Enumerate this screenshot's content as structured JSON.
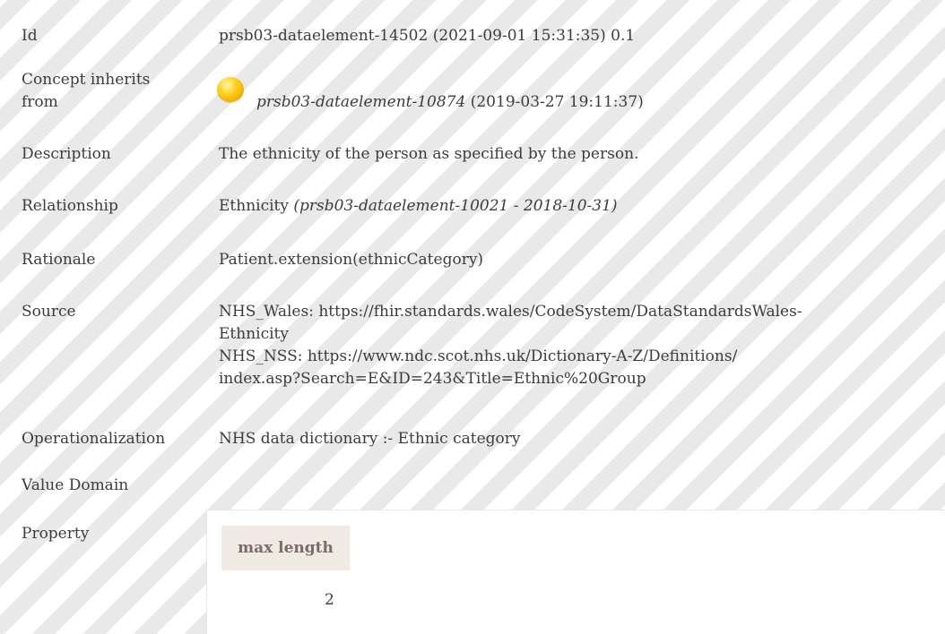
{
  "fields": {
    "id": {
      "label": "Id",
      "value": "prsb03-dataelement-14502 (2021-09-01 15:31:35) 0.1"
    },
    "inherits": {
      "label_line1": "Concept inherits",
      "label_line2": "from",
      "ref": "prsb03-dataelement-10874",
      "date": "(2019-03-27 19:11:37)",
      "icon": "orange-status-orb-icon",
      "icon_color": "#ffd21c"
    },
    "description": {
      "label": "Description",
      "value": "The ethnicity of the person as specified by the person."
    },
    "relationship": {
      "label": "Relationship",
      "name": "Ethnicity",
      "ref": "(prsb03-dataelement-10021 - 2018-10-31)"
    },
    "rationale": {
      "label": "Rationale",
      "value": "Patient.extension(ethnicCategory)"
    },
    "source": {
      "label": "Source",
      "lines": [
        "NHS_Wales: https://fhir.standards.wales/CodeSystem/DataStandardsWales-",
        "Ethnicity",
        "NHS_NSS: https://www.ndc.scot.nhs.uk/Dictionary-A-Z/Definitions/",
        "index.asp?Search=E&ID=243&Title=Ethnic%20Group"
      ]
    },
    "operationalization": {
      "label": "Operationalization",
      "value": "NHS data dictionary :- Ethnic category"
    },
    "value_domain": {
      "label": "Value Domain"
    },
    "property": {
      "label": "Property",
      "header": "max length",
      "value": "2"
    }
  },
  "colors": {
    "text": "#3c3c3c",
    "stripe_light": "#ffffff",
    "stripe_dark": "#e9e9e9",
    "property_header_bg": "#efeae4",
    "property_header_text": "#7a6d64"
  }
}
